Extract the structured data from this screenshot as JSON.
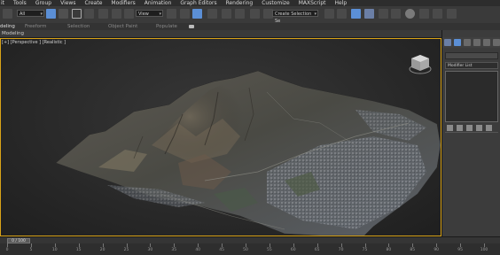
{
  "menubar": [
    "it",
    "Tools",
    "Group",
    "Views",
    "Create",
    "Modifiers",
    "Animation",
    "Graph Editors",
    "Rendering",
    "Customize",
    "MAXScript",
    "Help"
  ],
  "toolbar": {
    "selection_filter": "All",
    "ref_coord": "View",
    "named_selection": "Create Selection Se"
  },
  "ribbon": {
    "tabs": [
      "deling",
      "Freeform",
      "Selection",
      "Object Paint",
      "Populate"
    ],
    "subtitle": "Modeling"
  },
  "viewport": {
    "label": "[+] [Perspective ] [Realistic ]",
    "border_color": "#d9a318",
    "viewcube_icon": "viewcube-icon"
  },
  "command_panel": {
    "modifier_list_label": "Modifier List"
  },
  "timeline": {
    "slider_label": "0 / 100",
    "ticks": [
      "0",
      "5",
      "10",
      "15",
      "20",
      "25",
      "30",
      "35",
      "40",
      "45",
      "50",
      "55",
      "60",
      "65",
      "70",
      "75",
      "80",
      "85",
      "90",
      "95",
      "100"
    ]
  }
}
